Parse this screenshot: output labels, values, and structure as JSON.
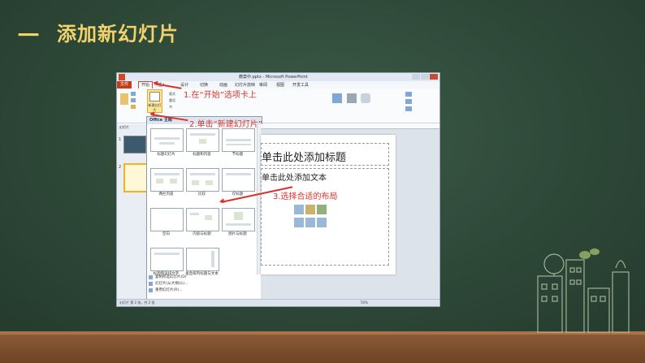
{
  "slide": {
    "heading_dash": "一",
    "heading": "添加新幻灯片"
  },
  "window": {
    "title": "教案中.pptx - Microsoft PowerPoint",
    "tabs": [
      "文件",
      "开始",
      "插入",
      "设计",
      "切换",
      "动画",
      "幻灯片放映",
      "审阅",
      "视图",
      "开发工具"
    ],
    "new_slide_label": "新建幻灯片",
    "ribbon_small": [
      "版式",
      "重设",
      "节"
    ],
    "left_pane_header": "幻灯片",
    "gallery_header": "Office 主题",
    "layouts": [
      "标题幻灯片",
      "标题和内容",
      "节标题",
      "两栏内容",
      "比较",
      "仅标题",
      "空白",
      "内容与标题",
      "图片与标题",
      "标题和竖排文字",
      "垂直排列标题与文本"
    ],
    "gallery_menu": [
      "复制所选幻灯片(D)",
      "幻灯片(从大纲)(L)...",
      "重用幻灯片(R)..."
    ],
    "placeholder_title": "单击此处添加标题",
    "placeholder_body": "单击此处添加文本",
    "status_left": "幻灯片 第 2 张，共 2 张",
    "status_zoom": "50%"
  },
  "annotations": {
    "step1": "1.在“开始”选项卡上",
    "step2": "2.单击“新建幻灯片”",
    "step3": "3.选择合适的布局"
  },
  "colors": {
    "board": "#2d4737",
    "heading": "#f2d36b",
    "annotation": "#d9332b",
    "file_tab": "#c43e1c"
  }
}
